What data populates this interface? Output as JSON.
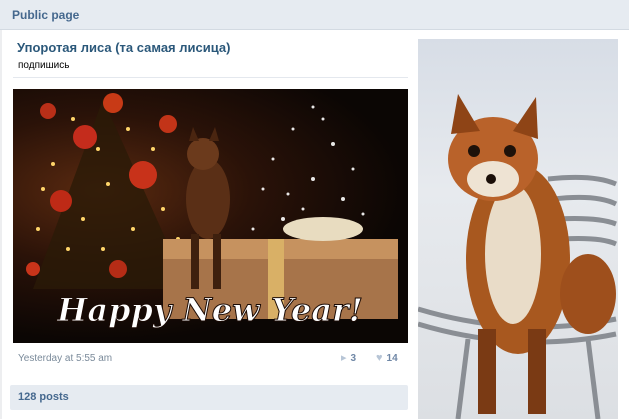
{
  "header": {
    "title": "Public page"
  },
  "post": {
    "title": "Упоротая лиса (та самая лисица)",
    "subtitle": "подпишись",
    "image_caption": "Happy New Year!",
    "timestamp": "Yesterday at 5:55 am",
    "shares": "3",
    "likes": "14"
  },
  "footer": {
    "posts_count": "128 posts"
  },
  "icons": {
    "share": "megaphone-icon",
    "like": "heart-icon"
  },
  "colors": {
    "accent": "#45688e",
    "link": "#2b587a",
    "bar_bg": "#e6ebf1"
  }
}
